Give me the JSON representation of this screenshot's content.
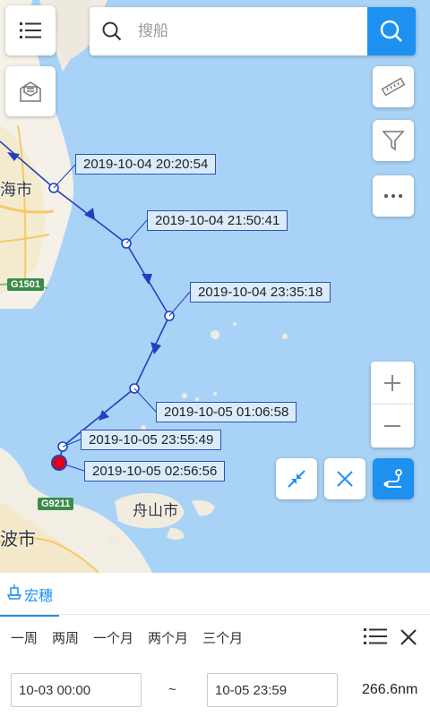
{
  "search": {
    "placeholder": "搜船"
  },
  "track_points": [
    {
      "time": "2019-10-04 20:20:54"
    },
    {
      "time": "2019-10-04 21:50:41"
    },
    {
      "time": "2019-10-04 23:35:18"
    },
    {
      "time": "2019-10-05 01:06:58"
    },
    {
      "time": "2019-10-05 23:55:49"
    },
    {
      "time": "2019-10-05 02:56:56"
    }
  ],
  "map_labels": {
    "city_top": "海市",
    "highway_1": "G1501",
    "highway_2": "G9211",
    "zhoushan": "舟山市",
    "ningbo": "波市"
  },
  "panel": {
    "ship_tab": "宏穗",
    "ranges": [
      "一周",
      "两周",
      "一个月",
      "两个月",
      "三个月"
    ],
    "start_time": "10-03 00:00",
    "separator": "~",
    "end_time": "10-05 23:59",
    "distance": "266.6nm"
  },
  "colors": {
    "accent": "#1d90f0",
    "track": "#2040c0",
    "current_point": "#e0001a"
  },
  "icons": {
    "menu": "list-icon",
    "message": "envelope-icon",
    "search": "search-icon",
    "ruler": "ruler-icon",
    "filter": "filter-icon",
    "more": "more-icon",
    "zoom_in": "plus-icon",
    "zoom_out": "minus-icon",
    "collapse": "collapse-icon",
    "close": "close-icon",
    "route": "route-icon"
  }
}
